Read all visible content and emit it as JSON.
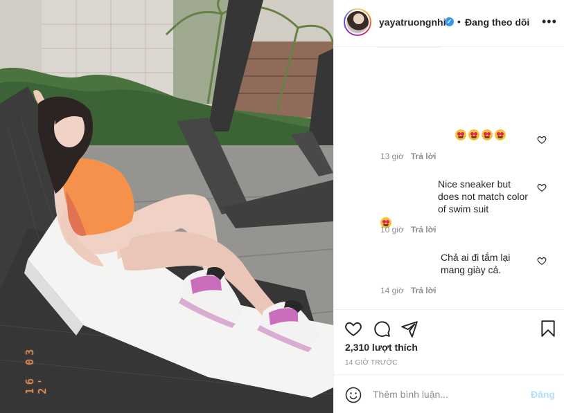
{
  "post": {
    "photo_date_stamp": "16 03 2'",
    "author": {
      "username": "yayatruongnhi",
      "verified": true,
      "follow_state": "Đang theo dõi"
    },
    "comments": [
      {
        "text": "",
        "emoji_count": 4,
        "time": "13 giờ",
        "reply_label": "Trả lời"
      },
      {
        "text": "Nice sneaker but does not match color of swim suit",
        "emoji_count": 1,
        "time": "10 giờ",
        "reply_label": "Trả lời"
      },
      {
        "text": "Chả ai đi tắm lại mang giày cả.",
        "emoji_count": 0,
        "time": "14 giờ",
        "reply_label": "Trả lời"
      }
    ],
    "likes_label": "2,310 lượt thích",
    "time_ago": "14 GIỜ TRƯỚC",
    "add_comment": {
      "placeholder": "Thêm bình luận...",
      "post_label": "Đăng"
    },
    "icons": [
      "more-icon",
      "heart-icon",
      "comment-icon",
      "share-icon",
      "bookmark-icon",
      "smile-icon",
      "verified-icon"
    ],
    "colors": {
      "verified": "#3897f0",
      "post_disabled": "#b2dffc",
      "muted": "#8e8e8e",
      "swimsuit": "#f58b3f"
    }
  }
}
